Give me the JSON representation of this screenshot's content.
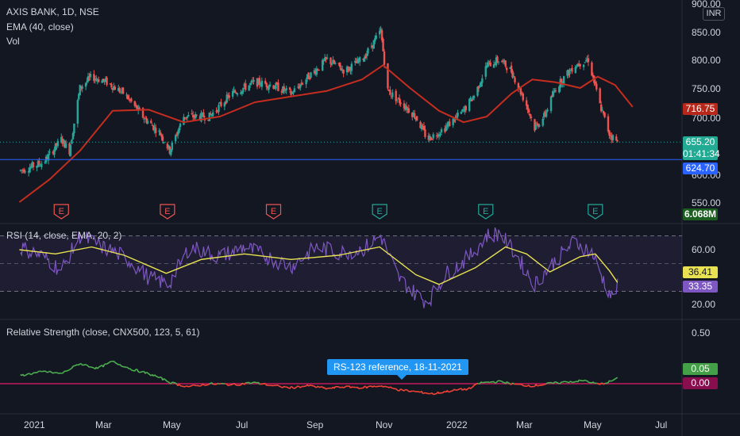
{
  "legend": {
    "symbol": "AXIS BANK, 1D, NSE",
    "ema": "EMA (40, close)",
    "vol": "Vol",
    "rsi": "RSI (14, close, EMA, 20, 2)",
    "rs": "Relative Strength (close, CNX500, 123, 5, 61)"
  },
  "currency_badge": "INR",
  "price_tags": {
    "ema": "716.75",
    "last": "655.20",
    "countdown": "01:41:34",
    "level": "624.70",
    "volume": "6.068M",
    "rsi_ema": "36.41",
    "rsi": "33.35",
    "rs": "0.05",
    "rs_zero": "0.00"
  },
  "callout": "RS-123 reference, 18-11-2021",
  "earnings_marker": "E",
  "colors": {
    "background": "#131722",
    "up": "#26a69a",
    "down": "#ef5350",
    "ema": "#c62d1f",
    "level": "#2962ff",
    "rsi": "#7e57c2",
    "rsi_ema": "#e8e252",
    "rs_pos": "#4caf50",
    "rs_neg": "#f44336",
    "rs_ref": "#c2185b"
  },
  "chart_data": [
    {
      "type": "candlestick",
      "title": "AXIS BANK, 1D, NSE",
      "x_ticks": [
        "2021",
        "Mar",
        "May",
        "Jul",
        "Sep",
        "Nov",
        "2022",
        "Mar",
        "May",
        "Jul"
      ],
      "y_ticks": [
        "900.00",
        "850.00",
        "800.00",
        "750.00",
        "700.00",
        "600.00",
        "550.00"
      ],
      "ylim": [
        520,
        905
      ],
      "timeline": [
        "2021-01-01",
        "2022-07-20"
      ],
      "close_path": [
        [
          "2020-12-20",
          605
        ],
        [
          "2021-01-10",
          620
        ],
        [
          "2021-01-25",
          660
        ],
        [
          "2021-02-01",
          640
        ],
        [
          "2021-02-10",
          750
        ],
        [
          "2021-02-20",
          770
        ],
        [
          "2021-03-05",
          760
        ],
        [
          "2021-03-20",
          740
        ],
        [
          "2021-04-05",
          700
        ],
        [
          "2021-04-20",
          670
        ],
        [
          "2021-04-28",
          640
        ],
        [
          "2021-05-10",
          700
        ],
        [
          "2021-06-01",
          700
        ],
        [
          "2021-06-20",
          740
        ],
        [
          "2021-07-10",
          760
        ],
        [
          "2021-07-25",
          755
        ],
        [
          "2021-08-10",
          740
        ],
        [
          "2021-08-25",
          770
        ],
        [
          "2021-09-10",
          800
        ],
        [
          "2021-09-25",
          780
        ],
        [
          "2021-10-10",
          800
        ],
        [
          "2021-10-20",
          830
        ],
        [
          "2021-10-26",
          850
        ],
        [
          "2021-11-01",
          745
        ],
        [
          "2021-11-15",
          720
        ],
        [
          "2021-11-25",
          700
        ],
        [
          "2021-12-05",
          660
        ],
        [
          "2021-12-20",
          680
        ],
        [
          "2022-01-05",
          710
        ],
        [
          "2022-01-15",
          740
        ],
        [
          "2022-01-25",
          790
        ],
        [
          "2022-02-05",
          800
        ],
        [
          "2022-02-15",
          780
        ],
        [
          "2022-02-28",
          720
        ],
        [
          "2022-03-07",
          680
        ],
        [
          "2022-03-15",
          700
        ],
        [
          "2022-03-25",
          750
        ],
        [
          "2022-04-10",
          790
        ],
        [
          "2022-04-22",
          800
        ],
        [
          "2022-05-02",
          720
        ],
        [
          "2022-05-10",
          670
        ],
        [
          "2022-05-17",
          655.2
        ]
      ],
      "ema_40": [
        [
          "2020-12-20",
          550
        ],
        [
          "2021-01-15",
          590
        ],
        [
          "2021-02-10",
          640
        ],
        [
          "2021-03-10",
          710
        ],
        [
          "2021-04-10",
          712
        ],
        [
          "2021-05-10",
          690
        ],
        [
          "2021-06-10",
          700
        ],
        [
          "2021-07-10",
          725
        ],
        [
          "2021-08-10",
          735
        ],
        [
          "2021-09-10",
          745
        ],
        [
          "2021-10-10",
          765
        ],
        [
          "2021-10-28",
          790
        ],
        [
          "2021-11-20",
          750
        ],
        [
          "2021-12-15",
          710
        ],
        [
          "2022-01-05",
          690
        ],
        [
          "2022-01-25",
          700
        ],
        [
          "2022-02-15",
          740
        ],
        [
          "2022-03-05",
          765
        ],
        [
          "2022-03-25",
          760
        ],
        [
          "2022-04-15",
          750
        ],
        [
          "2022-04-30",
          770
        ],
        [
          "2022-05-15",
          755
        ],
        [
          "2022-05-30",
          716.75
        ]
      ],
      "last_price": 655.2,
      "horizontal_level": 624.7,
      "ema_last": 716.75,
      "volume_last": "6.068M",
      "earnings_dates": [
        {
          "date": "2021-01-25",
          "result": "miss"
        },
        {
          "date": "2021-04-26",
          "result": "miss"
        },
        {
          "date": "2021-07-26",
          "result": "miss"
        },
        {
          "date": "2021-10-25",
          "result": "beat"
        },
        {
          "date": "2022-01-24",
          "result": "beat"
        },
        {
          "date": "2022-04-28",
          "result": "beat"
        }
      ]
    },
    {
      "type": "line",
      "title": "RSI (14, close, EMA, 20, 2)",
      "y_ticks": [
        "60.00",
        "20.00"
      ],
      "ylim": [
        15,
        80
      ],
      "bands": [
        70,
        50,
        30
      ],
      "series": [
        {
          "name": "RSI",
          "values": [
            [
              "2020-12-20",
              62
            ],
            [
              "2021-01-10",
              55
            ],
            [
              "2021-01-25",
              45
            ],
            [
              "2021-02-10",
              70
            ],
            [
              "2021-03-01",
              62
            ],
            [
              "2021-03-20",
              55
            ],
            [
              "2021-04-10",
              40
            ],
            [
              "2021-04-27",
              35
            ],
            [
              "2021-05-15",
              62
            ],
            [
              "2021-06-10",
              55
            ],
            [
              "2021-07-01",
              62
            ],
            [
              "2021-07-20",
              55
            ],
            [
              "2021-08-10",
              48
            ],
            [
              "2021-09-01",
              62
            ],
            [
              "2021-09-20",
              58
            ],
            [
              "2021-10-10",
              60
            ],
            [
              "2021-10-26",
              70
            ],
            [
              "2021-11-10",
              40
            ],
            [
              "2021-11-25",
              28
            ],
            [
              "2021-12-05",
              22
            ],
            [
              "2021-12-20",
              42
            ],
            [
              "2022-01-10",
              55
            ],
            [
              "2022-01-25",
              70
            ],
            [
              "2022-02-05",
              72
            ],
            [
              "2022-02-20",
              55
            ],
            [
              "2022-03-07",
              35
            ],
            [
              "2022-03-20",
              48
            ],
            [
              "2022-04-10",
              66
            ],
            [
              "2022-04-25",
              58
            ],
            [
              "2022-05-05",
              38
            ],
            [
              "2022-05-12",
              26
            ],
            [
              "2022-05-17",
              33.35
            ]
          ]
        },
        {
          "name": "EMA",
          "values": [
            [
              "2020-12-20",
              60
            ],
            [
              "2021-01-20",
              57
            ],
            [
              "2021-02-20",
              62
            ],
            [
              "2021-03-20",
              56
            ],
            [
              "2021-04-25",
              43
            ],
            [
              "2021-05-25",
              53
            ],
            [
              "2021-07-01",
              57
            ],
            [
              "2021-08-10",
              53
            ],
            [
              "2021-09-20",
              56
            ],
            [
              "2021-10-25",
              62
            ],
            [
              "2021-11-25",
              42
            ],
            [
              "2021-12-15",
              35
            ],
            [
              "2022-01-15",
              47
            ],
            [
              "2022-02-10",
              62
            ],
            [
              "2022-02-28",
              57
            ],
            [
              "2022-03-20",
              44
            ],
            [
              "2022-04-15",
              55
            ],
            [
              "2022-04-28",
              57
            ],
            [
              "2022-05-10",
              45
            ],
            [
              "2022-05-17",
              36.41
            ]
          ]
        }
      ]
    },
    {
      "type": "line",
      "title": "Relative Strength (close, CNX500, 123, 5, 61)",
      "y_ticks": [
        "0.50",
        "0.00"
      ],
      "ylim": [
        -0.15,
        0.55
      ],
      "reference_line": 0.0,
      "annotation": "RS-123 reference, 18-11-2021",
      "series": [
        {
          "name": "Relative Strength",
          "values": [
            [
              "2020-12-20",
              0.08
            ],
            [
              "2021-01-10",
              0.12
            ],
            [
              "2021-01-25",
              0.1
            ],
            [
              "2021-02-10",
              0.2
            ],
            [
              "2021-02-25",
              0.15
            ],
            [
              "2021-03-10",
              0.22
            ],
            [
              "2021-03-25",
              0.15
            ],
            [
              "2021-04-15",
              0.08
            ],
            [
              "2021-05-01",
              0.0
            ],
            [
              "2021-05-15",
              -0.03
            ],
            [
              "2021-06-01",
              0.0
            ],
            [
              "2021-06-20",
              -0.01
            ],
            [
              "2021-07-10",
              0.01
            ],
            [
              "2021-07-25",
              -0.02
            ],
            [
              "2021-08-10",
              -0.04
            ],
            [
              "2021-08-25",
              -0.02
            ],
            [
              "2021-09-10",
              -0.05
            ],
            [
              "2021-09-25",
              -0.03
            ],
            [
              "2021-10-10",
              -0.04
            ],
            [
              "2021-10-26",
              -0.02
            ],
            [
              "2021-11-10",
              -0.06
            ],
            [
              "2021-11-25",
              -0.08
            ],
            [
              "2021-12-10",
              -0.1
            ],
            [
              "2021-12-25",
              -0.07
            ],
            [
              "2022-01-10",
              -0.05
            ],
            [
              "2022-01-20",
              0.01
            ],
            [
              "2022-02-05",
              0.02
            ],
            [
              "2022-02-20",
              -0.01
            ],
            [
              "2022-03-05",
              -0.02
            ],
            [
              "2022-03-20",
              0.0
            ],
            [
              "2022-04-05",
              0.02
            ],
            [
              "2022-04-20",
              0.03
            ],
            [
              "2022-05-01",
              -0.01
            ],
            [
              "2022-05-10",
              0.02
            ],
            [
              "2022-05-17",
              0.05
            ]
          ]
        }
      ]
    }
  ]
}
